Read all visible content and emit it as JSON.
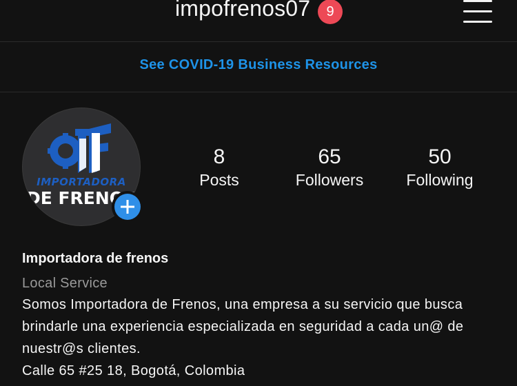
{
  "header": {
    "username": "impofrenos07",
    "notification_count": "9"
  },
  "banner": {
    "covid_link": "See COVID-19 Business Resources"
  },
  "profile": {
    "logo_line_1": "IMPORTADORA",
    "logo_line_2": "DE FRENOS",
    "stats": [
      {
        "value": "8",
        "label": "Posts"
      },
      {
        "value": "65",
        "label": "Followers"
      },
      {
        "value": "50",
        "label": "Following"
      }
    ]
  },
  "bio": {
    "name": "Importadora de frenos",
    "category": "Local Service",
    "description": "Somos Importadora de Frenos, una empresa a su servicio que busca brindarle una experiencia especializada en seguridad a cada un@ de nuestr@s clientes.",
    "address": "Calle 65 #25 18, Bogotá, Colombia"
  },
  "icons": {
    "menu": "hamburger-menu-icon",
    "add": "plus-icon"
  },
  "colors": {
    "background": "#121212",
    "link": "#1e93e8",
    "badge": "#ed4956",
    "add_button": "#2f8fe8",
    "logo_blue": "#1d5fc2"
  }
}
